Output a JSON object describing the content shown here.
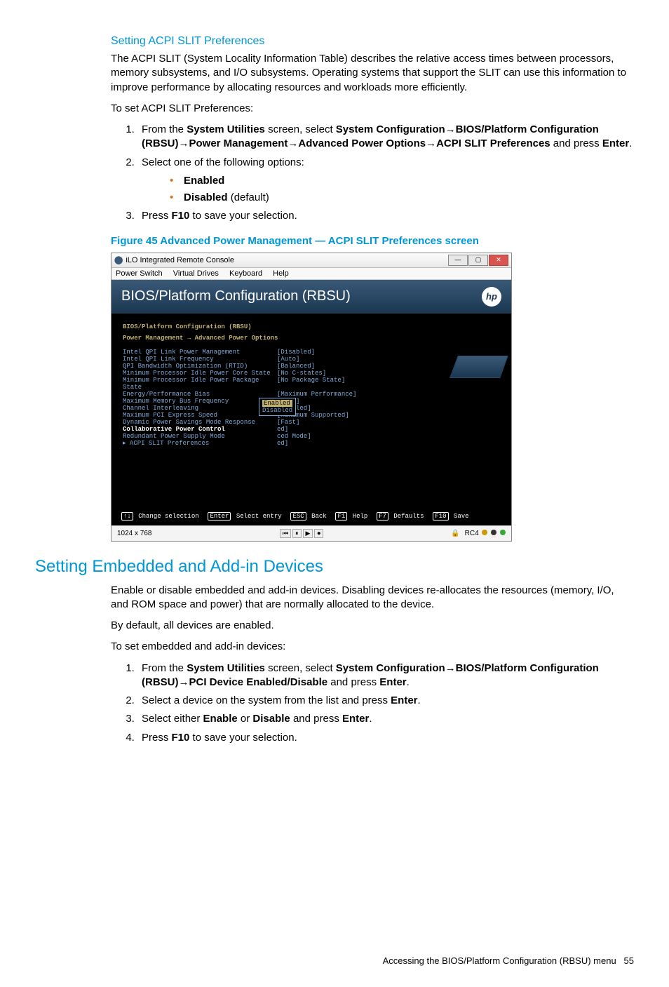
{
  "h_acpi": "Setting ACPI SLIT Preferences",
  "p_acpi_desc": "The ACPI SLIT (System Locality Information Table) describes the relative access times between processors, memory subsystems, and I/O subsystems. Operating systems that support the SLIT can use this information to improve performance by allocating resources and workloads more efficiently.",
  "p_acpi_to": "To set ACPI SLIT Preferences:",
  "step1": {
    "a": "From the ",
    "b": "System Utilities",
    "c": " screen, select ",
    "d": "System Configuration",
    "e": "BIOS/Platform Configuration (RBSU)",
    "f": "Power Management",
    "g": "Advanced Power Options",
    "h": "ACPI SLIT Preferences",
    "i": " and press ",
    "j": "Enter",
    "k": "."
  },
  "step2_intro": "Select one of the following options:",
  "opt_enabled": "Enabled",
  "opt_disabled_a": "Disabled",
  "opt_disabled_b": " (default)",
  "step3_a": "Press ",
  "step3_b": "F10",
  "step3_c": " to save your selection.",
  "figcap": "Figure 45 Advanced Power Management — ACPI SLIT Preferences screen",
  "shot": {
    "title": "iLO Integrated Remote Console",
    "menubar": [
      "Power Switch",
      "Virtual Drives",
      "Keyboard",
      "Help"
    ],
    "bios_title": "BIOS/Platform Configuration (RBSU)",
    "crumb1": "BIOS/Platform Configuration (RBSU)",
    "crumb2": "Power Management → Advanced Power Options",
    "rows": [
      {
        "label": "Intel QPI Link Power Management",
        "val": "[Disabled]"
      },
      {
        "label": "Intel QPI Link Frequency",
        "val": "[Auto]"
      },
      {
        "label": "QPI Bandwidth Optimization (RTID)",
        "val": "[Balanced]"
      },
      {
        "label": "Minimum Processor Idle Power Core State",
        "val": "[No C-states]"
      },
      {
        "label": "Minimum Processor Idle Power Package State",
        "val": "[No Package State]"
      },
      {
        "label": "Energy/Performance Bias",
        "val": "[Maximum Performance]"
      },
      {
        "label": "Maximum Memory Bus Frequency",
        "val": "[Auto]"
      },
      {
        "label": "Channel Interleaving",
        "val": "[Enabled]"
      },
      {
        "label": "Maximum PCI Express Speed",
        "val": "[Maximum Supported]"
      },
      {
        "label": "Dynamic Power Savings Mode Response",
        "val": "[Fast]"
      },
      {
        "label": "Collaborative Power Control",
        "val": "ed]",
        "white": true
      },
      {
        "label": "Redundant Power Supply Mode",
        "val": "ced Mode]"
      },
      {
        "label": "ACPI SLIT Preferences",
        "val": "ed]",
        "arrow": true
      }
    ],
    "popup_sel": "Enabled",
    "popup_other": "Disabled",
    "footer_items": [
      {
        "k": "↑↓",
        "t": "Change selection"
      },
      {
        "k": "Enter",
        "t": "Select entry"
      },
      {
        "k": "ESC",
        "t": "Back"
      },
      {
        "k": "F1",
        "t": "Help"
      },
      {
        "k": "F7",
        "t": "Defaults"
      },
      {
        "k": "F10",
        "t": "Save"
      }
    ],
    "status_res": "1024 x 768",
    "status_rc": "RC4"
  },
  "h_embedded": "Setting Embedded and Add-in Devices",
  "p_emb_desc": "Enable or disable embedded and add-in devices. Disabling devices re-allocates the resources (memory, I/O, and ROM space and power) that are normally allocated to the device.",
  "p_emb_default": "By default, all devices are enabled.",
  "p_emb_to": "To set embedded and add-in devices:",
  "emb_step1": {
    "a": "From the ",
    "b": "System Utilities",
    "c": " screen, select ",
    "d": "System Configuration",
    "e": "BIOS/Platform Configuration (RBSU)",
    "f": "PCI Device Enabled/Disable",
    "g": " and press ",
    "h": "Enter",
    "i": "."
  },
  "emb_step2_a": "Select a device on the system from the list and press ",
  "emb_step2_b": "Enter",
  "emb_step2_c": ".",
  "emb_step3_a": "Select either ",
  "emb_step3_b": "Enable",
  "emb_step3_c": " or ",
  "emb_step3_d": "Disable",
  "emb_step3_e": " and press ",
  "emb_step3_f": "Enter",
  "emb_step3_g": ".",
  "emb_step4_a": "Press ",
  "emb_step4_b": "F10",
  "emb_step4_c": " to save your selection.",
  "footer_a": "Accessing the BIOS/Platform Configuration (RBSU) menu",
  "footer_b": "55"
}
